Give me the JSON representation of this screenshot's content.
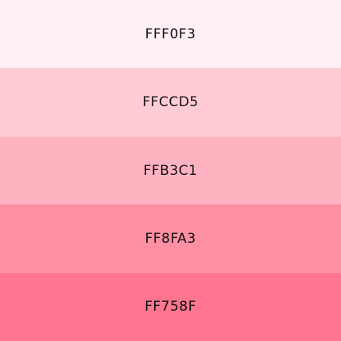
{
  "palette": {
    "swatches": [
      {
        "label": "FFF0F3",
        "color": "#FFF0F3"
      },
      {
        "label": "FFCCD5",
        "color": "#FFCCD5"
      },
      {
        "label": "FFB3C1",
        "color": "#FFB3C1"
      },
      {
        "label": "FF8FA3",
        "color": "#FF8FA3"
      },
      {
        "label": "FF758F",
        "color": "#FF758F"
      }
    ]
  }
}
